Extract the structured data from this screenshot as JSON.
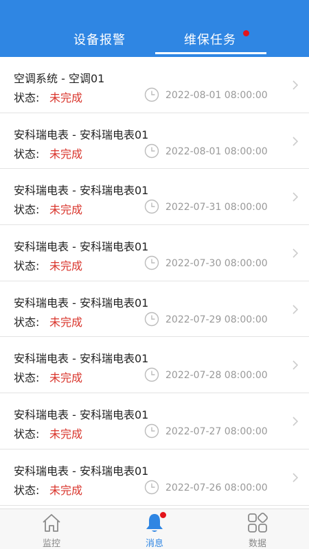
{
  "header": {
    "tabs": [
      {
        "label": "设备报警",
        "active": false
      },
      {
        "label": "维保任务",
        "active": true,
        "has_badge": true
      }
    ],
    "bg_color": "#2f86e3"
  },
  "list": {
    "status_label": "状态:",
    "status_color": "#d9342b",
    "items": [
      {
        "title": "空调系统 - 空调01",
        "status": "未完成",
        "time": "2022-08-01 08:00:00"
      },
      {
        "title": "安科瑞电表 - 安科瑞电表01",
        "status": "未完成",
        "time": "2022-08-01 08:00:00"
      },
      {
        "title": "安科瑞电表 - 安科瑞电表01",
        "status": "未完成",
        "time": "2022-07-31 08:00:00"
      },
      {
        "title": "安科瑞电表 - 安科瑞电表01",
        "status": "未完成",
        "time": "2022-07-30 08:00:00"
      },
      {
        "title": "安科瑞电表 - 安科瑞电表01",
        "status": "未完成",
        "time": "2022-07-29 08:00:00"
      },
      {
        "title": "安科瑞电表 - 安科瑞电表01",
        "status": "未完成",
        "time": "2022-07-28 08:00:00"
      },
      {
        "title": "安科瑞电表 - 安科瑞电表01",
        "status": "未完成",
        "time": "2022-07-27 08:00:00"
      },
      {
        "title": "安科瑞电表 - 安科瑞电表01",
        "status": "未完成",
        "time": "2022-07-26 08:00:00"
      }
    ]
  },
  "bottom_nav": {
    "items": [
      {
        "label": "监控",
        "icon": "home-icon",
        "active": false
      },
      {
        "label": "消息",
        "icon": "bell-icon",
        "active": true,
        "has_badge": true
      },
      {
        "label": "数据",
        "icon": "grid-icon",
        "active": false
      }
    ],
    "active_color": "#2f86e3"
  }
}
